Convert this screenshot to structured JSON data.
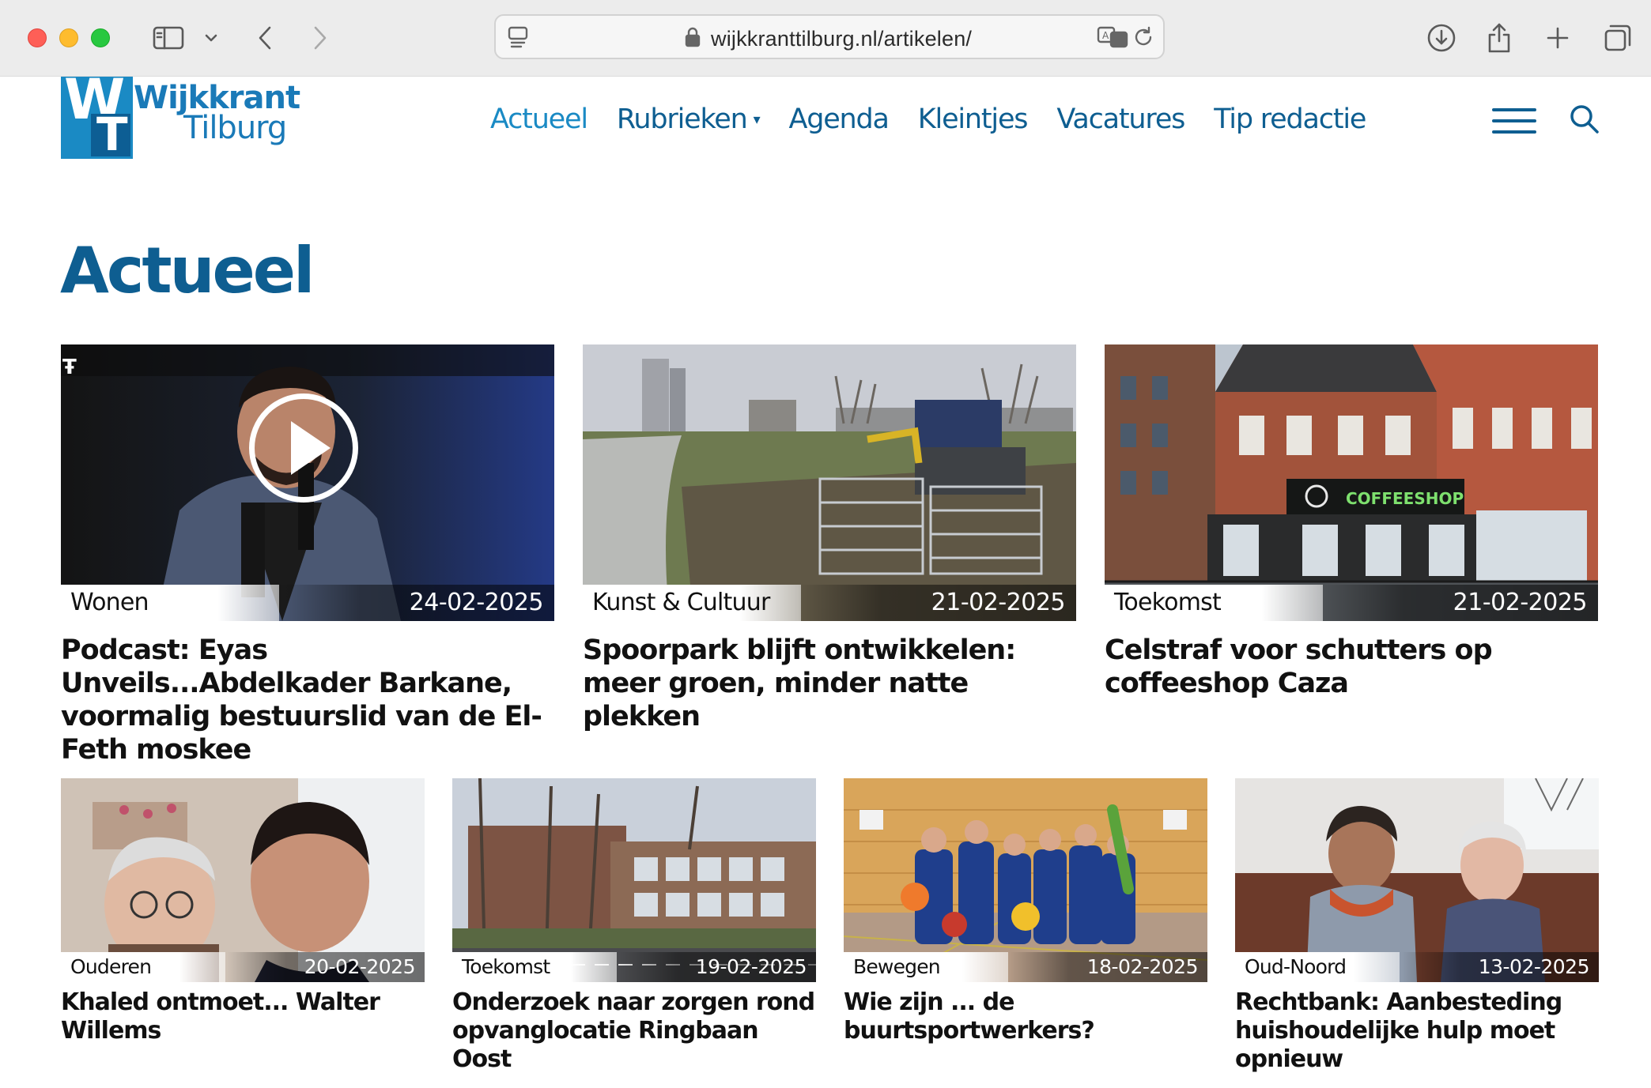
{
  "browser": {
    "url": "wijkkranttilburg.nl/artikelen/"
  },
  "site": {
    "logo_line1": "Wijkkrant",
    "logo_line2": "Tilburg",
    "logo_mark_w": "W",
    "logo_mark_t": "T"
  },
  "nav": {
    "items": [
      {
        "label": "Actueel",
        "active": true
      },
      {
        "label": "Rubrieken",
        "has_dropdown": true
      },
      {
        "label": "Agenda"
      },
      {
        "label": "Kleintjes"
      },
      {
        "label": "Vacatures"
      },
      {
        "label": "Tip redactie"
      }
    ],
    "dropdown_caret": "▾"
  },
  "page": {
    "title": "Actueel"
  },
  "articles": [
    {
      "category": "Wonen",
      "date": "24-02-2025",
      "title": "Podcast: Eyas Unveils...Abdelkader Barkane, voormalig bestuurslid van de El-Feth moskee",
      "video": true,
      "watermark": "Ŧ",
      "image": "podcast-portrait"
    },
    {
      "category": "Kunst & Cultuur",
      "date": "21-02-2025",
      "title": "Spoorpark blijft ontwikkelen: meer groen, minder natte plekken",
      "image": "park-excavator"
    },
    {
      "category": "Toekomst",
      "date": "21-02-2025",
      "title": "Celstraf voor schutters op coffeeshop Caza",
      "image": "coffeeshop-building",
      "sign_text": "COFFEESHOP"
    },
    {
      "category": "Ouderen",
      "date": "20-02-2025",
      "title": "Khaled ontmoet... Walter Willems",
      "image": "selfie-two-men"
    },
    {
      "category": "Toekomst",
      "date": "19-02-2025",
      "title": "Onderzoek naar zorgen rond opvanglocatie Ringbaan Oost",
      "image": "brick-school-building"
    },
    {
      "category": "Bewegen",
      "date": "18-02-2025",
      "title": "Wie zijn ... de buurtsportwerkers?",
      "image": "gym-team"
    },
    {
      "category": "Oud-Noord",
      "date": "13-02-2025",
      "title": "Rechtbank: Aanbesteding huishoudelijke hulp moet opnieuw",
      "image": "two-women-sofa"
    }
  ]
}
